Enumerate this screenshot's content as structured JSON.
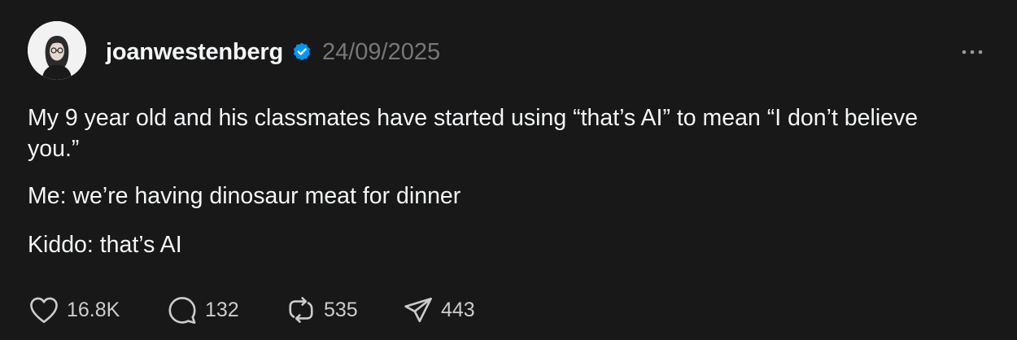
{
  "post": {
    "username": "joanwestenberg",
    "date": "24/09/2025",
    "verified": true,
    "paragraphs": [
      "My 9 year old and his classmates have started using “that’s AI” to mean “I don’t believe you.”",
      "Me: we’re having dinosaur meat for dinner",
      "Kiddo: that’s AI"
    ]
  },
  "actions": {
    "likes": "16.8K",
    "replies": "132",
    "reposts": "535",
    "shares": "443"
  },
  "icons": {
    "avatar": "avatar-icon",
    "verified": "verified-badge-icon",
    "more": "more-icon",
    "like": "heart-icon",
    "reply": "speech-bubble-icon",
    "repost": "repost-icon",
    "share": "paper-plane-icon"
  },
  "colors": {
    "background": "#181818",
    "text": "#f3f5f7",
    "muted": "#777777",
    "verified": "#0095f6"
  }
}
